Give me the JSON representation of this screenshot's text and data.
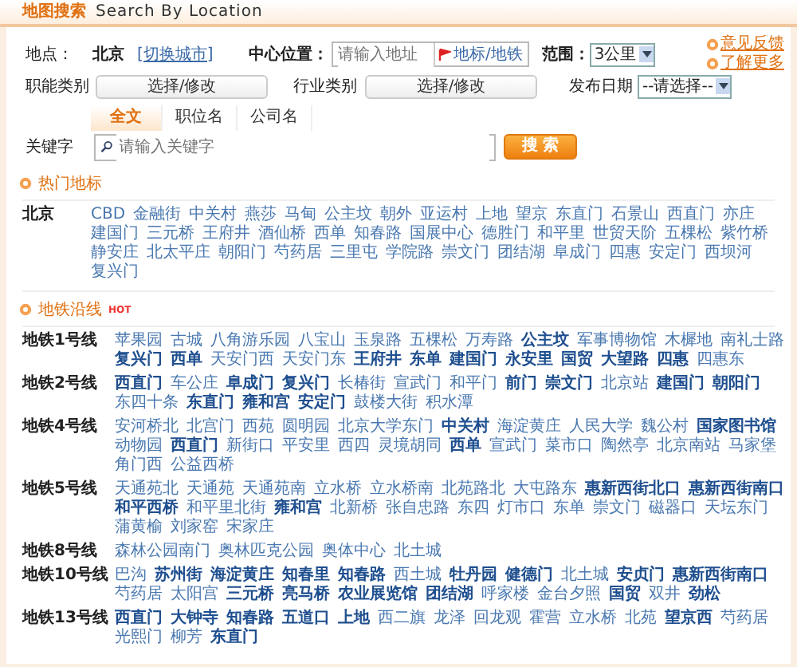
{
  "header": {
    "title": "地图搜索",
    "subtitle": "Search By Location"
  },
  "form": {
    "location_label": "地点：",
    "city": "北京",
    "switch_city": "[切换城市]",
    "center_label": "中心位置：",
    "center_placeholder": "请输入地址",
    "landmark_button": "地标/地铁",
    "range_label": "范围：",
    "range_value": "3公里",
    "links": [
      "意见反馈",
      "了解更多"
    ],
    "function_label": "职能类别",
    "function_button": "选择/修改",
    "industry_label": "行业类别",
    "industry_button": "选择/修改",
    "date_label": "发布日期",
    "date_value": "--请选择--",
    "tabs": [
      {
        "label": "全文",
        "selected": true
      },
      {
        "label": "职位名",
        "selected": false
      },
      {
        "label": "公司名",
        "selected": false
      }
    ],
    "keyword_label": "关键字",
    "keyword_placeholder": "请输入关键字",
    "search_button": "搜 索"
  },
  "hot": {
    "title": "热门地标",
    "city": "北京",
    "places": [
      "CBD",
      "金融街",
      "中关村",
      "燕莎",
      "马甸",
      "公主坟",
      "朝外",
      "亚运村",
      "上地",
      "望京",
      "东直门",
      "石景山",
      "西直门",
      "亦庄",
      "建国门",
      "三元桥",
      "王府井",
      "酒仙桥",
      "西单",
      "知春路",
      "国展中心",
      "德胜门",
      "和平里",
      "世贸天阶",
      "五棵松",
      "紫竹桥",
      "静安庄",
      "北太平庄",
      "朝阳门",
      "芍药居",
      "三里屯",
      "学院路",
      "崇文门",
      "团结湖",
      "阜成门",
      "四惠",
      "安定门",
      "西坝河",
      "复兴门"
    ]
  },
  "subway": {
    "title": "地铁沿线",
    "badge": "HOT",
    "lines": [
      {
        "name": "地铁1号线",
        "stations": [
          {
            "name": "苹果园",
            "bold": false
          },
          {
            "name": "古城",
            "bold": false
          },
          {
            "name": "八角游乐园",
            "bold": false
          },
          {
            "name": "八宝山",
            "bold": false
          },
          {
            "name": "玉泉路",
            "bold": false
          },
          {
            "name": "五棵松",
            "bold": false
          },
          {
            "name": "万寿路",
            "bold": false
          },
          {
            "name": "公主坟",
            "bold": true
          },
          {
            "name": "军事博物馆",
            "bold": false
          },
          {
            "name": "木樨地",
            "bold": false
          },
          {
            "name": "南礼士路",
            "bold": false
          },
          {
            "name": "复兴门",
            "bold": true
          },
          {
            "name": "西单",
            "bold": true
          },
          {
            "name": "天安门西",
            "bold": false
          },
          {
            "name": "天安门东",
            "bold": false
          },
          {
            "name": "王府井",
            "bold": true
          },
          {
            "name": "东单",
            "bold": true
          },
          {
            "name": "建国门",
            "bold": true
          },
          {
            "name": "永安里",
            "bold": true
          },
          {
            "name": "国贸",
            "bold": true
          },
          {
            "name": "大望路",
            "bold": true
          },
          {
            "name": "四惠",
            "bold": true
          },
          {
            "name": "四惠东",
            "bold": false
          }
        ]
      },
      {
        "name": "地铁2号线",
        "stations": [
          {
            "name": "西直门",
            "bold": true
          },
          {
            "name": "车公庄",
            "bold": false
          },
          {
            "name": "阜成门",
            "bold": true
          },
          {
            "name": "复兴门",
            "bold": true
          },
          {
            "name": "长椿街",
            "bold": false
          },
          {
            "name": "宣武门",
            "bold": false
          },
          {
            "name": "和平门",
            "bold": false
          },
          {
            "name": "前门",
            "bold": true
          },
          {
            "name": "崇文门",
            "bold": true
          },
          {
            "name": "北京站",
            "bold": false
          },
          {
            "name": "建国门",
            "bold": true
          },
          {
            "name": "朝阳门",
            "bold": true
          },
          {
            "name": "东四十条",
            "bold": false
          },
          {
            "name": "东直门",
            "bold": true
          },
          {
            "name": "雍和宫",
            "bold": true
          },
          {
            "name": "安定门",
            "bold": true
          },
          {
            "name": "鼓楼大街",
            "bold": false
          },
          {
            "name": "积水潭",
            "bold": false
          }
        ]
      },
      {
        "name": "地铁4号线",
        "stations": [
          {
            "name": "安河桥北",
            "bold": false
          },
          {
            "name": "北宫门",
            "bold": false
          },
          {
            "name": "西苑",
            "bold": false
          },
          {
            "name": "圆明园",
            "bold": false
          },
          {
            "name": "北京大学东门",
            "bold": false
          },
          {
            "name": "中关村",
            "bold": true
          },
          {
            "name": "海淀黄庄",
            "bold": false
          },
          {
            "name": "人民大学",
            "bold": false
          },
          {
            "name": "魏公村",
            "bold": false
          },
          {
            "name": "国家图书馆",
            "bold": true
          },
          {
            "name": "动物园",
            "bold": false
          },
          {
            "name": "西直门",
            "bold": true
          },
          {
            "name": "新街口",
            "bold": false
          },
          {
            "name": "平安里",
            "bold": false
          },
          {
            "name": "西四",
            "bold": false
          },
          {
            "name": "灵境胡同",
            "bold": false
          },
          {
            "name": "西单",
            "bold": true
          },
          {
            "name": "宣武门",
            "bold": false
          },
          {
            "name": "菜市口",
            "bold": false
          },
          {
            "name": "陶然亭",
            "bold": false
          },
          {
            "name": "北京南站",
            "bold": false
          },
          {
            "name": "马家堡",
            "bold": false
          },
          {
            "name": "角门西",
            "bold": false
          },
          {
            "name": "公益西桥",
            "bold": false
          }
        ]
      },
      {
        "name": "地铁5号线",
        "stations": [
          {
            "name": "天通苑北",
            "bold": false
          },
          {
            "name": "天通苑",
            "bold": false
          },
          {
            "name": "天通苑南",
            "bold": false
          },
          {
            "name": "立水桥",
            "bold": false
          },
          {
            "name": "立水桥南",
            "bold": false
          },
          {
            "name": "北苑路北",
            "bold": false
          },
          {
            "name": "大屯路东",
            "bold": false
          },
          {
            "name": "惠新西街北口",
            "bold": true
          },
          {
            "name": "惠新西街南口",
            "bold": true
          },
          {
            "name": "和平西桥",
            "bold": true
          },
          {
            "name": "和平里北街",
            "bold": false
          },
          {
            "name": "雍和宫",
            "bold": true
          },
          {
            "name": "北新桥",
            "bold": false
          },
          {
            "name": "张自忠路",
            "bold": false
          },
          {
            "name": "东四",
            "bold": false
          },
          {
            "name": "灯市口",
            "bold": false
          },
          {
            "name": "东单",
            "bold": false
          },
          {
            "name": "崇文门",
            "bold": false
          },
          {
            "name": "磁器口",
            "bold": false
          },
          {
            "name": "天坛东门",
            "bold": false
          },
          {
            "name": "蒲黄榆",
            "bold": false
          },
          {
            "name": "刘家窑",
            "bold": false
          },
          {
            "name": "宋家庄",
            "bold": false
          }
        ]
      },
      {
        "name": "地铁8号线",
        "stations": [
          {
            "name": "森林公园南门",
            "bold": false
          },
          {
            "name": "奥林匹克公园",
            "bold": false
          },
          {
            "name": "奥体中心",
            "bold": false
          },
          {
            "name": "北土城",
            "bold": false
          }
        ]
      },
      {
        "name": "地铁10号线",
        "stations": [
          {
            "name": "巴沟",
            "bold": false
          },
          {
            "name": "苏州街",
            "bold": true
          },
          {
            "name": "海淀黄庄",
            "bold": true
          },
          {
            "name": "知春里",
            "bold": true
          },
          {
            "name": "知春路",
            "bold": true
          },
          {
            "name": "西土城",
            "bold": false
          },
          {
            "name": "牡丹园",
            "bold": true
          },
          {
            "name": "健德门",
            "bold": true
          },
          {
            "name": "北土城",
            "bold": false
          },
          {
            "name": "安贞门",
            "bold": true
          },
          {
            "name": "惠新西街南口",
            "bold": true
          },
          {
            "name": "芍药居",
            "bold": false
          },
          {
            "name": "太阳宫",
            "bold": false
          },
          {
            "name": "三元桥",
            "bold": true
          },
          {
            "name": "亮马桥",
            "bold": true
          },
          {
            "name": "农业展览馆",
            "bold": true
          },
          {
            "name": "团结湖",
            "bold": true
          },
          {
            "name": "呼家楼",
            "bold": false
          },
          {
            "name": "金台夕照",
            "bold": false
          },
          {
            "name": "国贸",
            "bold": true
          },
          {
            "name": "双井",
            "bold": false
          },
          {
            "name": "劲松",
            "bold": true
          }
        ]
      },
      {
        "name": "地铁13号线",
        "stations": [
          {
            "name": "西直门",
            "bold": true
          },
          {
            "name": "大钟寺",
            "bold": true
          },
          {
            "name": "知春路",
            "bold": true
          },
          {
            "name": "五道口",
            "bold": true
          },
          {
            "name": "上地",
            "bold": true
          },
          {
            "name": "西二旗",
            "bold": false
          },
          {
            "name": "龙泽",
            "bold": false
          },
          {
            "name": "回龙观",
            "bold": false
          },
          {
            "name": "霍营",
            "bold": false
          },
          {
            "name": "立水桥",
            "bold": false
          },
          {
            "name": "北苑",
            "bold": false
          },
          {
            "name": "望京西",
            "bold": true
          },
          {
            "name": "芍药居",
            "bold": false
          },
          {
            "name": "光熙门",
            "bold": false
          },
          {
            "name": "柳芳",
            "bold": false
          },
          {
            "name": "东直门",
            "bold": true
          }
        ]
      }
    ]
  }
}
